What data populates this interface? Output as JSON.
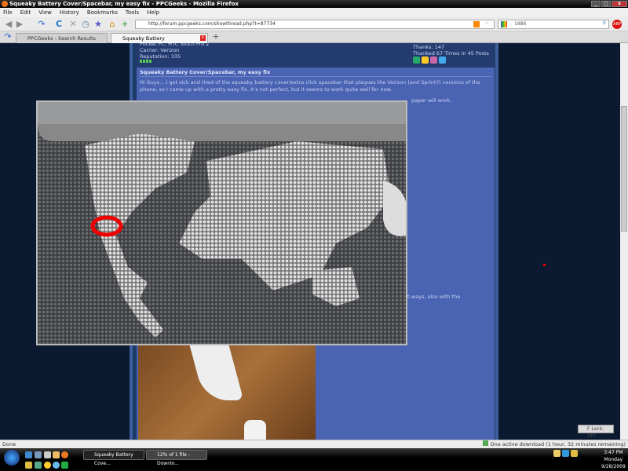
{
  "window": {
    "title": "Squeaky Battery Cover/Spacebar, my easy fix - PPCGeeks - Mozilla Firefox"
  },
  "menu": [
    "File",
    "Edit",
    "View",
    "History",
    "Bookmarks",
    "Tools",
    "Help"
  ],
  "navbar": {
    "url": "http://forum.ppcgeeks.com/showthread.php?t=87734",
    "search": "1886"
  },
  "tabs": [
    {
      "label": "PPCGeeks - Search Results"
    },
    {
      "label": "Squeaky Battery Cover/Spaceba..."
    }
  ],
  "userinfo": {
    "device": "Pocket PC: HTC Touch Pro 2",
    "carrier": "Carrier: Verizon",
    "reputation": "Reputation: 335",
    "thanks": "Thanks: 147",
    "thanked": "Thanked 67 Times in 45 Posts"
  },
  "post": {
    "title": "Squeaky Battery Cover/Spacebar, my easy fix",
    "p1": "Hi Guys....I got sick and tired of the squeaky battery cover/extra click spacebar that plagues the Verizon (and Sprint?) versions of the phone, so I came up with a pretty easy fix. It's not perfect, but it seems to work quite well for now.",
    "p2_fragment": "paper will work.",
    "p3_fragment": "t-ways, also with the"
  },
  "floating": {
    "flock": "F Lock: OFF"
  },
  "status": {
    "left": "Done",
    "download": "One active download (1 hour, 32 minutes remaining)"
  },
  "taskbar": {
    "tasks": [
      "Squeaky Battery Cove...",
      "12% of 1 file - Downlo..."
    ],
    "time": "3:47 PM",
    "day": "Monday",
    "date": "9/28/2009"
  }
}
